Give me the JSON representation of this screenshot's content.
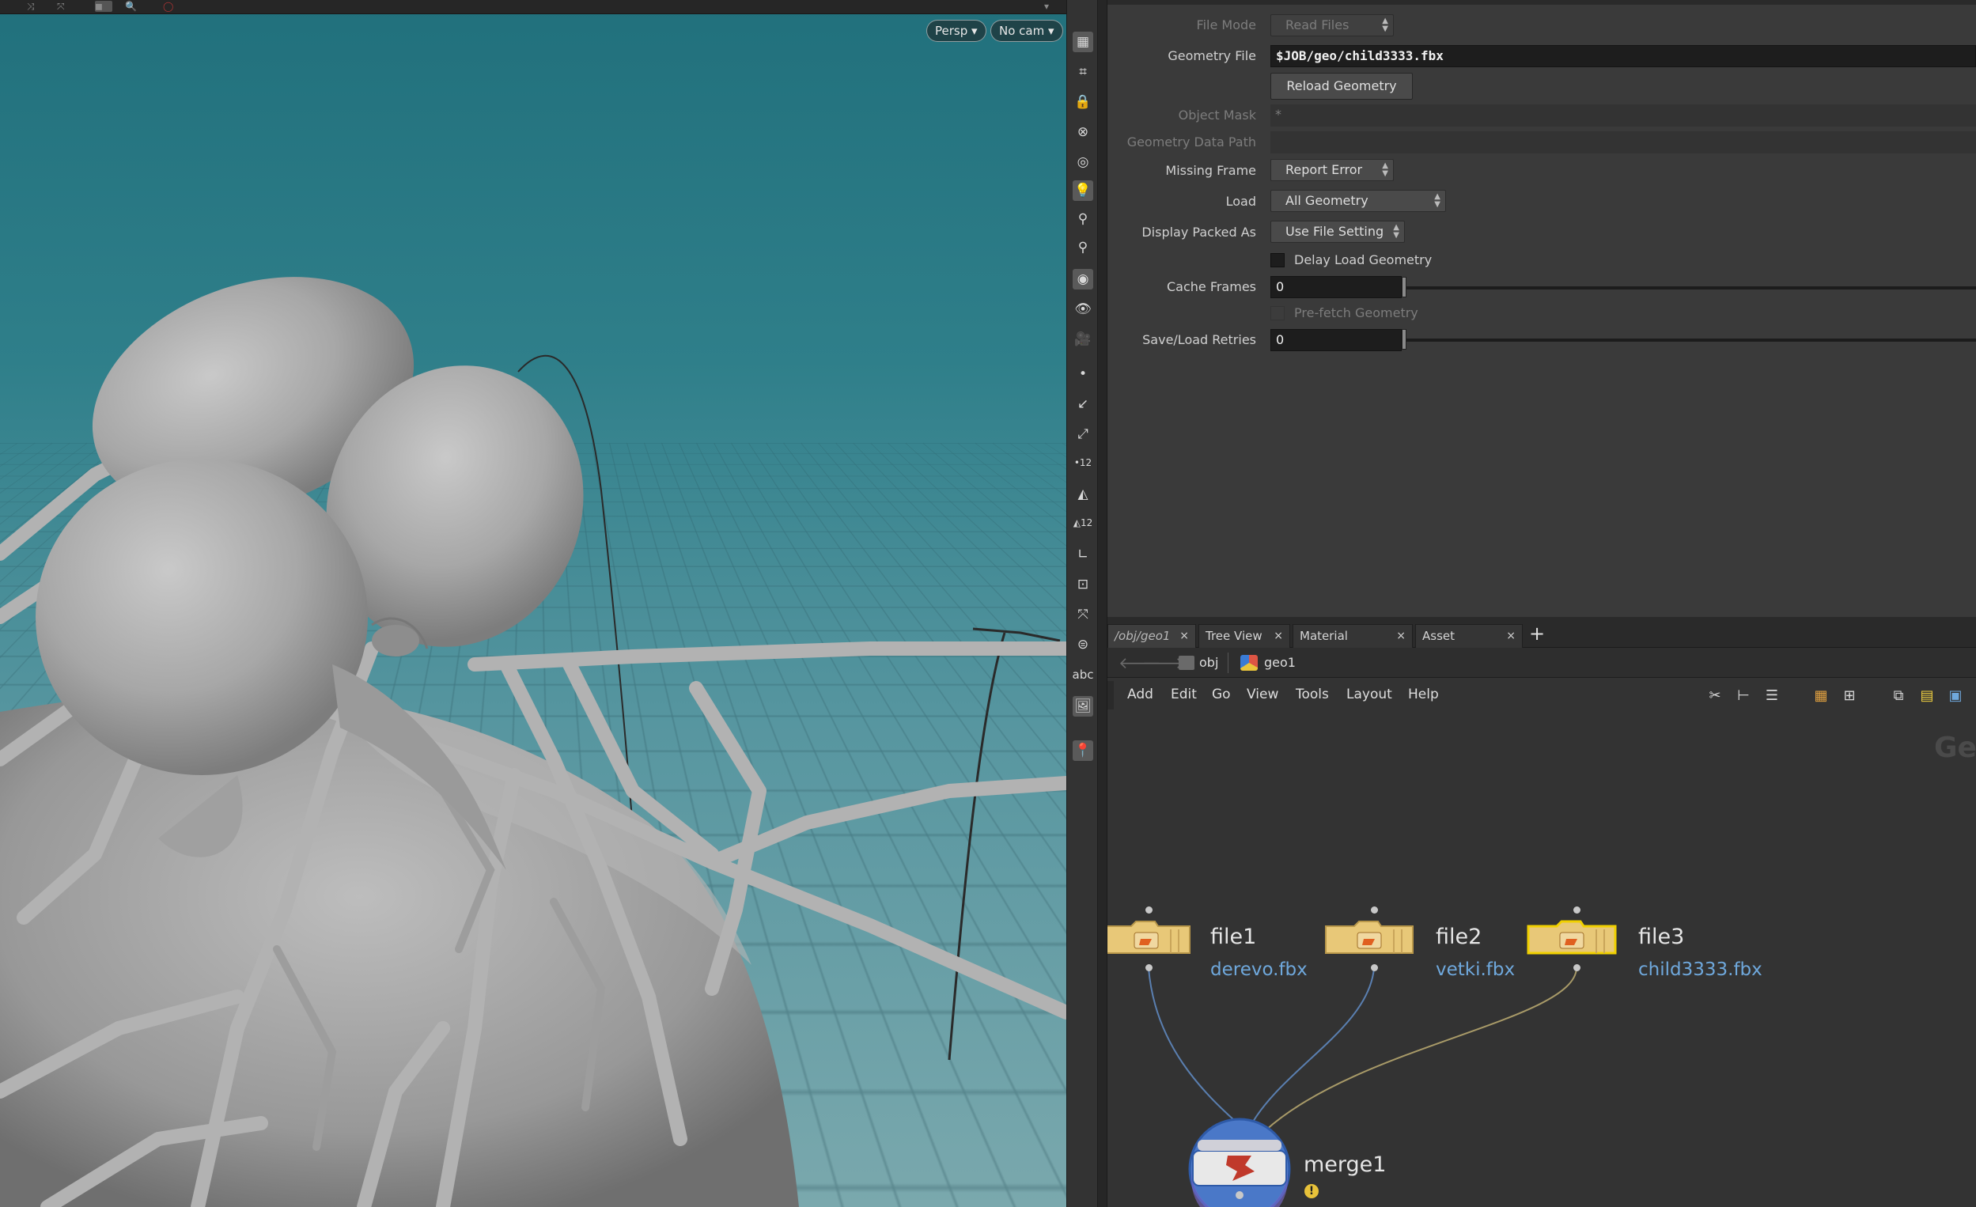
{
  "viewport": {
    "camera_mode": "Persp",
    "camera": "No cam",
    "toolbar_text": "abc",
    "badge_a": "12",
    "badge_b": "12"
  },
  "parameters": {
    "file_mode": {
      "label": "File Mode",
      "value": "Read Files"
    },
    "geometry_file": {
      "label": "Geometry File",
      "value": "$JOB/geo/child3333.fbx"
    },
    "reload_button": "Reload Geometry",
    "object_mask": {
      "label": "Object Mask",
      "value": "*"
    },
    "geometry_data_path": {
      "label": "Geometry Data Path",
      "value": ""
    },
    "missing_frame": {
      "label": "Missing Frame",
      "value": "Report Error"
    },
    "load": {
      "label": "Load",
      "value": "All Geometry"
    },
    "display_packed_as": {
      "label": "Display Packed As",
      "value": "Use File Setting"
    },
    "delay_load": {
      "label": "Delay Load Geometry",
      "checked": false
    },
    "cache_frames": {
      "label": "Cache Frames",
      "value": "0"
    },
    "prefetch": {
      "label": "Pre-fetch Geometry",
      "checked": false
    },
    "save_load_retries": {
      "label": "Save/Load Retries",
      "value": "0"
    }
  },
  "network": {
    "tabs": [
      {
        "label": "/obj/geo1",
        "close": "×"
      },
      {
        "label": "Tree View",
        "close": "×"
      },
      {
        "label": "Material Palette",
        "close": "×"
      },
      {
        "label": "Asset Browser",
        "close": "×"
      }
    ],
    "add_tab": "+",
    "path": {
      "back": "🡐",
      "forward": "🡒",
      "obj": "obj",
      "geo": "geo1"
    },
    "menu": [
      "Add",
      "Edit",
      "Go",
      "View",
      "Tools",
      "Layout",
      "Help"
    ],
    "watermark": "Geo",
    "nodes": [
      {
        "name": "file1",
        "file": "derevo.fbx",
        "selected": false
      },
      {
        "name": "file2",
        "file": "vetki.fbx",
        "selected": false
      },
      {
        "name": "file3",
        "file": "child3333.fbx",
        "selected": true
      },
      {
        "name": "merge1",
        "warning": "!"
      }
    ],
    "colors": {
      "folder": "#e8c878",
      "folder_dark": "#b8974a",
      "selected_outline": "#f0d000",
      "merge": "#4a78c8",
      "wire_blue": "#5a7fb0",
      "wire_yellow": "#a89a68",
      "file_link": "#6fa8dc"
    }
  },
  "icons": {
    "viewport_toolbar": [
      "grid-icon",
      "snap-icon",
      "lock-icon",
      "cross-icon",
      "ghost-icon",
      "light-icon",
      "light-bulb-icon",
      "light-pin-icon",
      "camera-shade-icon",
      "eye-icon",
      "camera-icon",
      "point-icon",
      "normal-icon",
      "pin-icon",
      "point-number-icon",
      "prim-icon",
      "prim-number-icon",
      "angle-icon",
      "bbox-icon",
      "handle-icon",
      "stack-icon",
      "abc-text",
      "image-icon",
      "pin-map-icon"
    ],
    "network_toolbar": [
      "wrench-icon",
      "tree-icon",
      "list-icon",
      "color-palette-icon",
      "grid-view-icon",
      "layout-icon",
      "sticky-note-icon",
      "image-add-icon"
    ]
  }
}
